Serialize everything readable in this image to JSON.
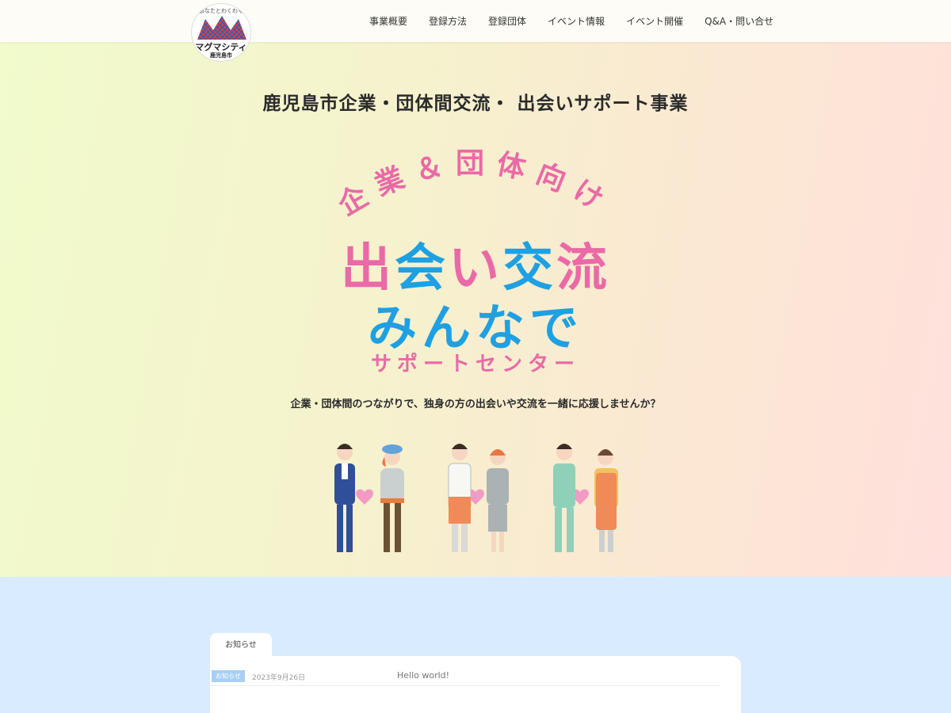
{
  "header": {
    "logo": {
      "tagline": "あなたとわくわく",
      "name": "マグマシティ",
      "city": "鹿児島市"
    },
    "nav": [
      "事業概要",
      "登録方法",
      "登録団体",
      "イベント情報",
      "イベント開催",
      "Q&A・問い合せ"
    ]
  },
  "hero": {
    "title": "鹿児島市企業・団体間交流・ 出会いサポート事業",
    "logotype": {
      "arc_text": "企業＆団体向け",
      "line1": [
        "出",
        "会",
        "い",
        "交",
        "流"
      ],
      "line2": "みんなで",
      "line3": "サポートセンター"
    },
    "subtitle": "企業・団体間のつながりで、独身の方の出会いや交流を一緒に応援しませんか？",
    "illustration": "three-couples-with-hearts",
    "colors": {
      "pink": "#ea69a7",
      "blue": "#1ea0e2"
    }
  },
  "news": {
    "tab_label": "お知らせ",
    "items": [
      {
        "badge": "お知らせ",
        "date": "2023年9月26日",
        "title": "Hello world!"
      }
    ]
  }
}
